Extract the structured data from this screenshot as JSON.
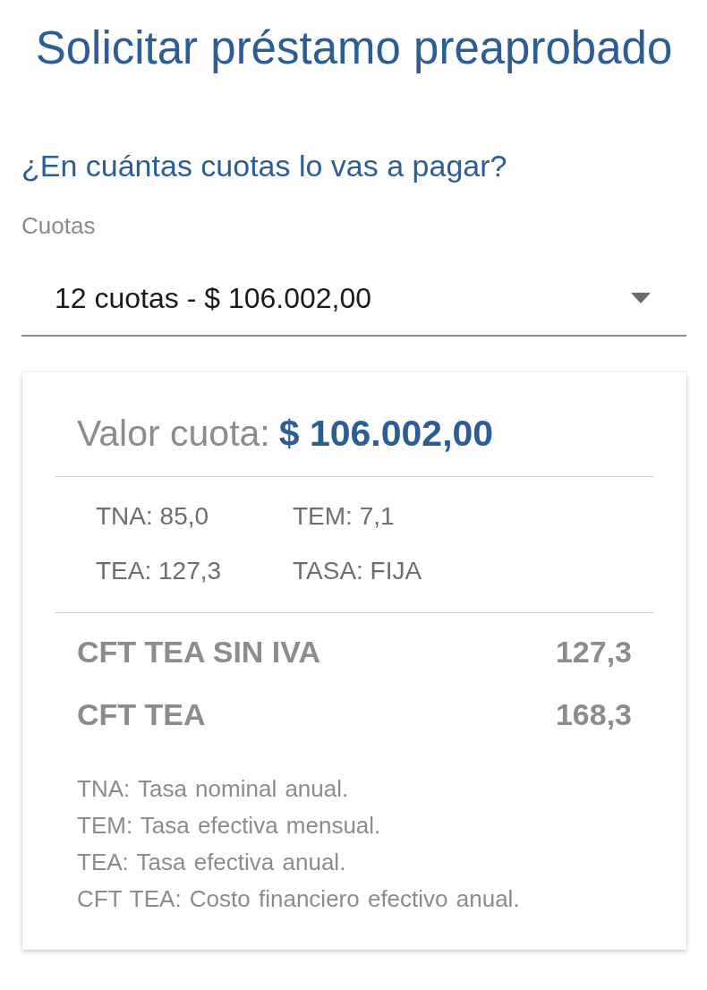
{
  "title": "Solicitar préstamo preaprobado",
  "question": "¿En cuántas cuotas lo vas a pagar?",
  "installments_select": {
    "label": "Cuotas",
    "value": "12 cuotas - $ 106.002,00"
  },
  "summary": {
    "installment_label": "Valor cuota:",
    "installment_amount": "$ 106.002,00",
    "rates": [
      {
        "text": "TNA: 85,0"
      },
      {
        "text": "TEM: 7,1"
      },
      {
        "text": "TEA: 127,3"
      },
      {
        "text": "TASA: FIJA"
      }
    ],
    "costs": [
      {
        "label": "CFT TEA SIN IVA",
        "value": "127,3"
      },
      {
        "label": "CFT TEA",
        "value": "168,3"
      }
    ],
    "glossary": [
      {
        "term": "TNA:",
        "definition": "Tasa nominal anual."
      },
      {
        "term": "TEM:",
        "definition": "Tasa efectiva mensual."
      },
      {
        "term": "TEA:",
        "definition": "Tasa efectiva anual."
      },
      {
        "term": "CFT TEA:",
        "definition": "Costo financiero efectivo anual."
      }
    ]
  }
}
